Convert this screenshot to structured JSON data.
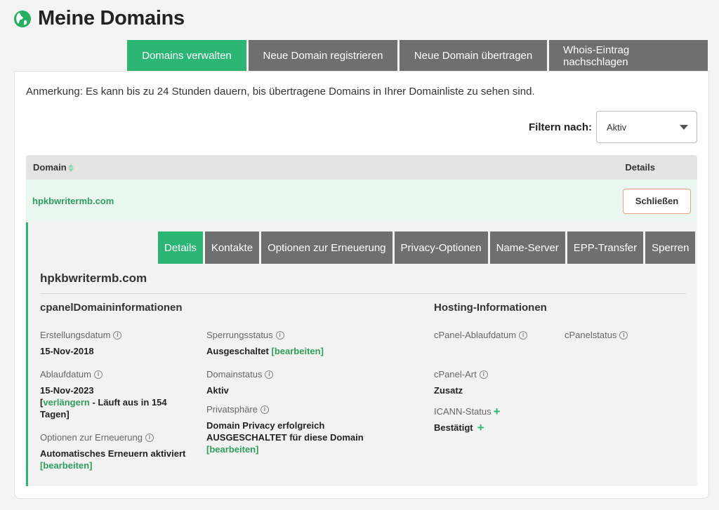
{
  "header": {
    "title": "Meine Domains",
    "icon": "globe-icon"
  },
  "top_tabs": [
    "Domains verwalten",
    "Neue Domain registrieren",
    "Neue Domain übertragen",
    "Whois-Eintrag nachschlagen"
  ],
  "note": "Anmerkung: Es kann bis zu 24 Stunden dauern, bis übertragene Domains in Ihrer Domainliste zu sehen sind.",
  "filter": {
    "label": "Filtern nach:",
    "selected": "Aktiv"
  },
  "table": {
    "headers": {
      "domain": "Domain",
      "details": "Details"
    },
    "row": {
      "domain": "hpkbwritermb.com",
      "button": "Schließen"
    }
  },
  "detail": {
    "tabs": [
      "Details",
      "Kontakte",
      "Optionen zur Erneuerung",
      "Privacy-Optionen",
      "Name-Server",
      "EPP-Transfer",
      "Sperren"
    ],
    "domain": "hpkbwritermb.com",
    "section_left": "cpanelDomaininformationen",
    "section_right": "Hosting-Informationen",
    "created_label": "Erstellungsdatum",
    "created_value": "15-Nov-2018",
    "expiry_label": "Ablaufdatum",
    "expiry_value": "15-Nov-2023",
    "expiry_renew_open": "[",
    "expiry_renew_link": "verlängern",
    "expiry_renew_text": " - Läuft aus in 154 Tagen]",
    "renewal_label": "Optionen zur Erneuerung",
    "renewal_value": "Automatisches Erneuern aktiviert",
    "edit_link": "[bearbeiten]",
    "lock_label": "Sperrungsstatus",
    "lock_value": "Ausgeschaltet",
    "status_label": "Domainstatus",
    "status_value": "Aktiv",
    "privacy_label": "Privatsphäre",
    "privacy_value": "Domain Privacy erfolgreich AUSGESCHALTET für diese Domain",
    "cpanel_expiry_label": "cPanel-Ablaufdatum",
    "cpanel_status_label": "cPanelstatus",
    "cpanel_type_label": "cPanel-Art",
    "cpanel_type_value": "Zusatz",
    "icann_label": "ICANN-Status",
    "icann_value": "Bestätigt"
  }
}
